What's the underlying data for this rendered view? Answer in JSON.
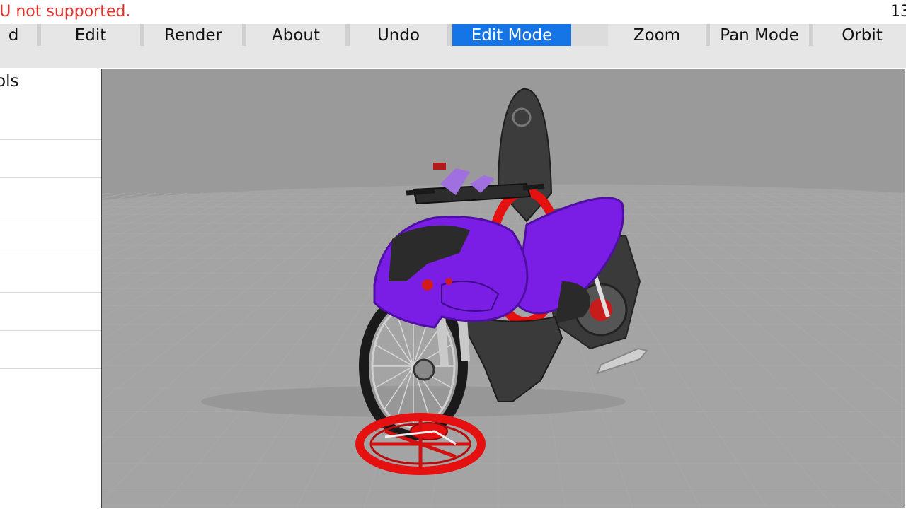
{
  "status": {
    "message": "PU not supported.",
    "corner": "13"
  },
  "toolbar": {
    "items": [
      {
        "label": "d"
      },
      {
        "label": "Edit"
      },
      {
        "label": "Render"
      },
      {
        "label": "About"
      },
      {
        "label": "Undo"
      },
      {
        "label": "Edit Mode",
        "active": true
      },
      {
        "label": ""
      },
      {
        "label": "Zoom"
      },
      {
        "label": "Pan Mode"
      },
      {
        "label": "Orbit"
      }
    ],
    "active_color": "#1574e6"
  },
  "left_panel": {
    "title": "ols"
  },
  "viewport": {
    "background": "#9a9a9a",
    "grid_color": "#a8a8a8",
    "model": "scooter-model",
    "body_color": "#7a1ee6",
    "wheel_color": "#e51010"
  }
}
